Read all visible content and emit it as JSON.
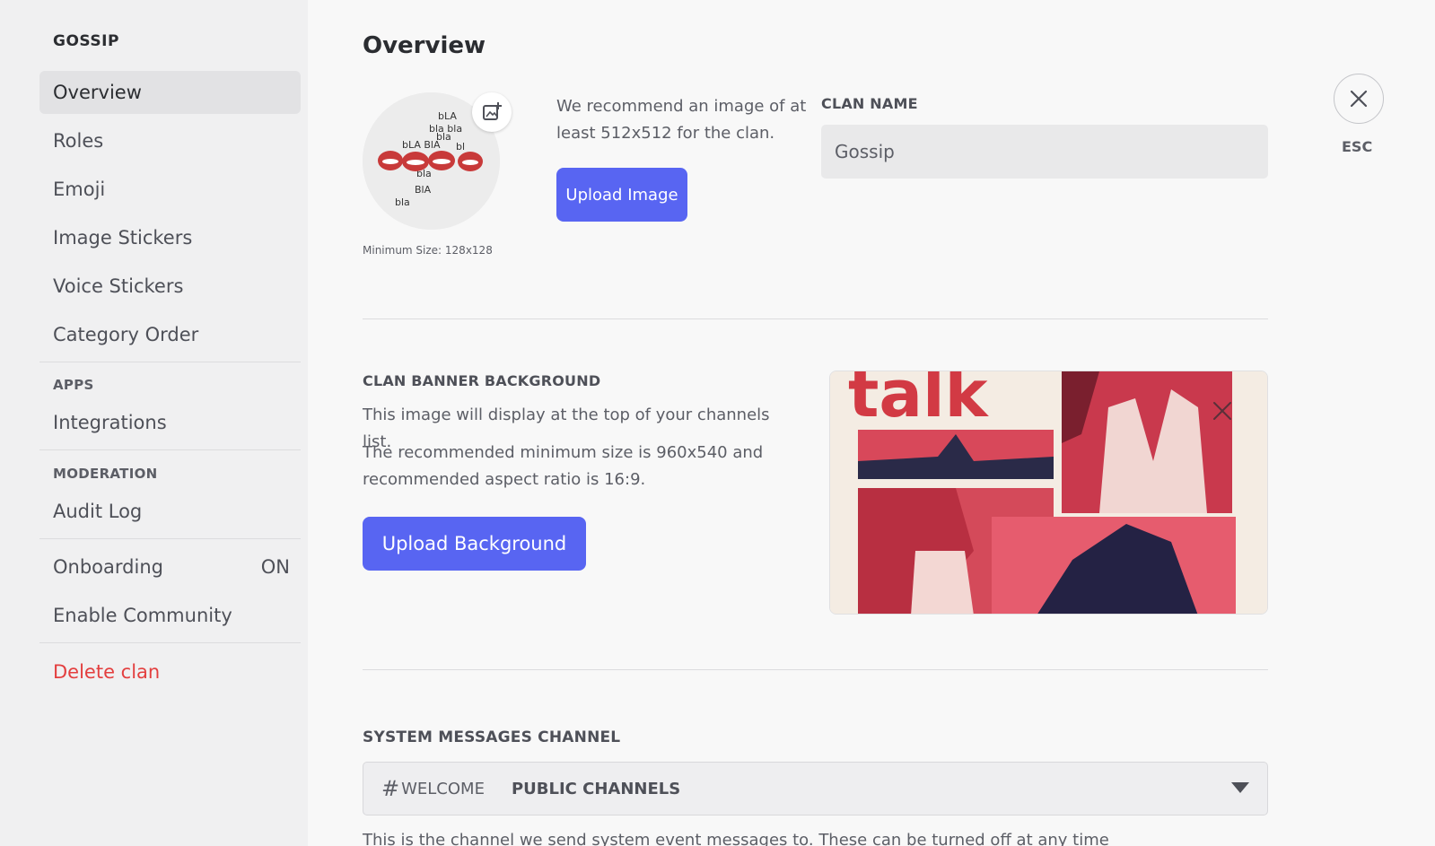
{
  "sidebar": {
    "title": "GOSSIP",
    "items": [
      {
        "label": "Overview"
      },
      {
        "label": "Roles"
      },
      {
        "label": "Emoji"
      },
      {
        "label": "Image Stickers"
      },
      {
        "label": "Voice Stickers"
      },
      {
        "label": "Category Order"
      }
    ],
    "apps_header": "APPS",
    "apps_items": [
      {
        "label": "Integrations"
      }
    ],
    "moderation_header": "MODERATION",
    "moderation_items": [
      {
        "label": "Audit Log"
      }
    ],
    "onboarding": {
      "label": "Onboarding",
      "badge": "ON"
    },
    "enable_community": "Enable Community",
    "delete_clan": "Delete clan"
  },
  "main": {
    "title": "Overview",
    "avatar": {
      "min_size": "Minimum Size: 128x128"
    },
    "recommend_text": "We recommend an image of at least 512x512 for the clan.",
    "upload_image_label": "Upload Image",
    "clan_name": {
      "label": "CLAN NAME",
      "value": "Gossip"
    },
    "esc_label": "ESC",
    "banner": {
      "label": "CLAN BANNER BACKGROUND",
      "text1": "This image will display at the top of your channels list.",
      "text2": "The recommended minimum size is 960x540 and recommended aspect ratio is 16:9.",
      "upload_label": "Upload Background",
      "preview_word": "talk"
    },
    "system_messages": {
      "label": "SYSTEM MESSAGES CHANNEL",
      "hash": "#",
      "channel": "WELCOME",
      "category": "PUBLIC CHANNELS",
      "help": "This is the channel we send system event messages to. These can be turned off at any time"
    }
  },
  "colors": {
    "accent": "#5865f2",
    "danger": "#e33f3f",
    "sidebar_bg": "#f0f0f1",
    "main_bg": "#f8f8f8"
  }
}
